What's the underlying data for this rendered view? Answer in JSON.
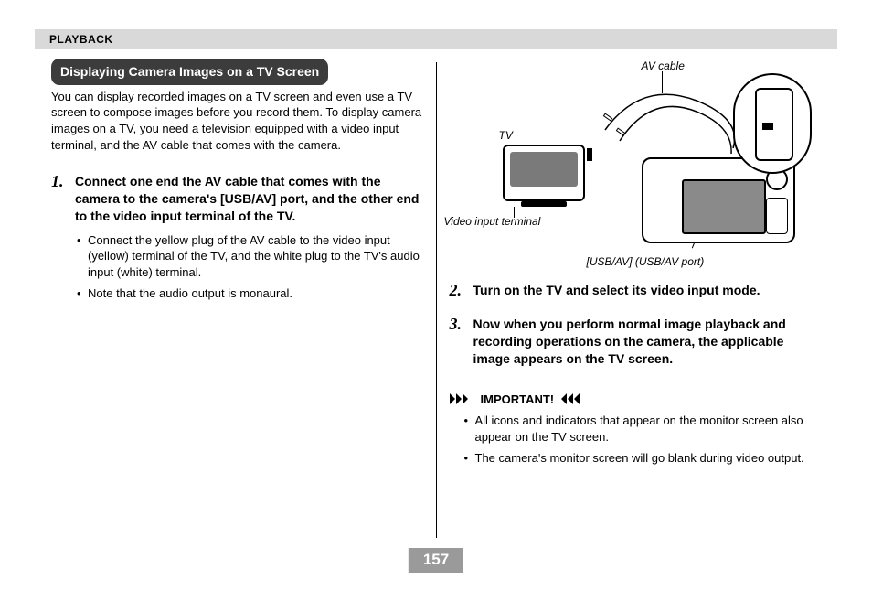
{
  "header": {
    "section": "PLAYBACK"
  },
  "page_number": "157",
  "left": {
    "title": "Displaying Camera Images on a TV Screen",
    "intro": "You can display recorded images on a TV screen and even use a TV screen to compose images before you record them. To display camera images on a TV, you need a television equipped with a video input terminal, and the AV cable that comes with the camera.",
    "steps": [
      {
        "num": "1.",
        "text": "Connect one end the AV cable that comes with the camera to the camera's [USB/AV] port, and the other end to the video input terminal of the TV.",
        "bullets": [
          "Connect the yellow plug of the AV cable to the video input (yellow) terminal of the TV, and the white plug to the TV's audio input (white) terminal.",
          "Note that the audio output is monaural."
        ]
      }
    ]
  },
  "diagram": {
    "av_cable": "AV cable",
    "tv": "TV",
    "video_input_terminal": "Video input terminal",
    "usb_av_port": "[USB/AV] (USB/AV port)"
  },
  "right": {
    "steps": [
      {
        "num": "2.",
        "text": "Turn on the TV and select its video input mode."
      },
      {
        "num": "3.",
        "text": "Now when you perform normal image playback and recording operations on the camera, the applicable image appears on the TV screen."
      }
    ],
    "important_label": "IMPORTANT!",
    "important_bullets": [
      "All icons and indicators that appear on the monitor screen also appear on the TV screen.",
      "The camera's monitor screen will go blank during video output."
    ]
  }
}
